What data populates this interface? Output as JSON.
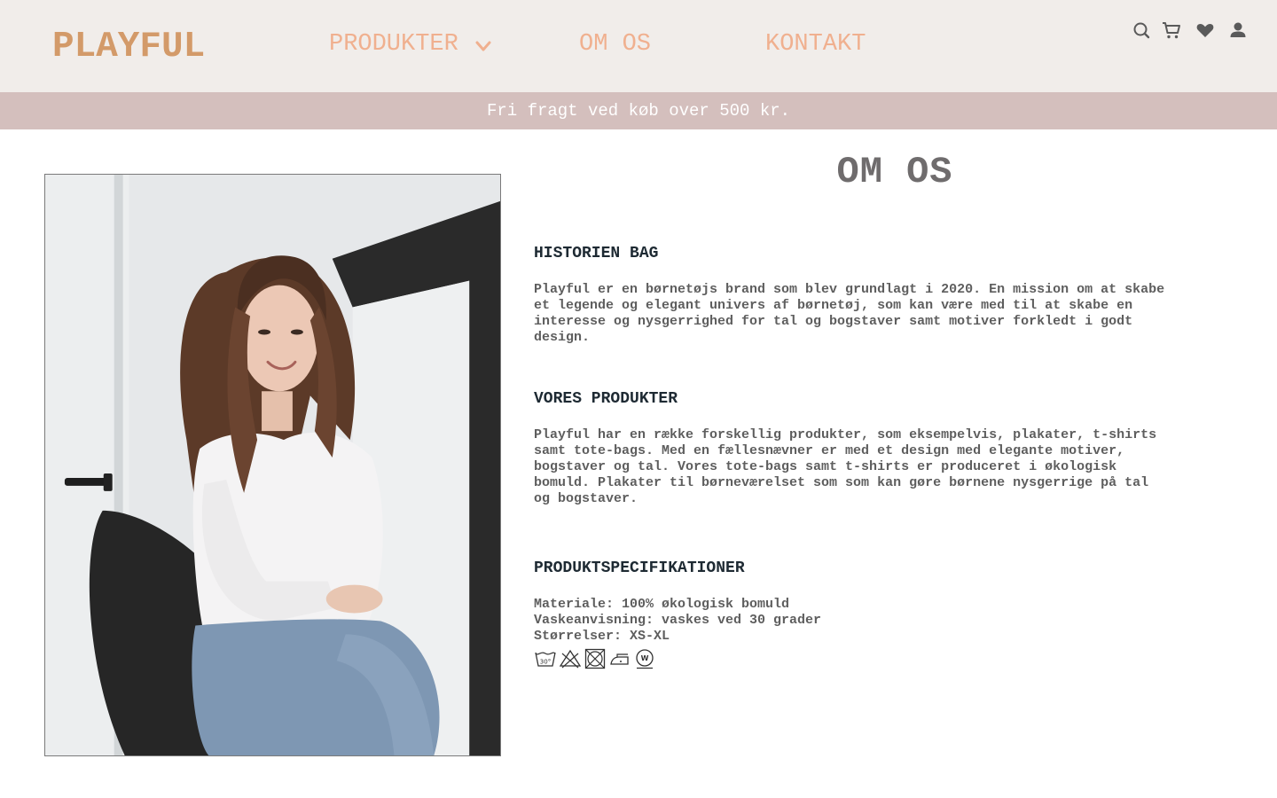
{
  "header": {
    "logo": "PLAYFUL",
    "nav": {
      "produkter": "PRODUKTER",
      "om_os": "OM OS",
      "kontakt": "KONTAKT"
    },
    "icons": [
      "search-icon",
      "cart-icon",
      "heart-icon",
      "user-icon"
    ]
  },
  "banner": {
    "text": "Fri fragt ved køb over 500 kr."
  },
  "main": {
    "title": "OM OS",
    "sections": [
      {
        "title": "HISTORIEN BAG",
        "text": "Playful er en børnetøjs brand som blev grundlagt i 2020. En mission om at skabe\net legende og elegant univers af børnetøj, som kan være med til at skabe en\ninteresse og nysgerrighed for tal og bogstaver samt motiver forkledt i godt\ndesign."
      },
      {
        "title": "VORES PRODUKTER",
        "text": "Playful har en række forskellig produkter, som eksempelvis, plakater, t-shirts\nsamt tote-bags. Med en fællesnævner er med et design med elegante motiver,\nbogstaver og tal. Vores tote-bags samt t-shirts er produceret i økologisk\nbomuld. Plakater til børneværelset som som kan gøre børnene nysgerrige på tal\nog bogstaver."
      },
      {
        "title": "PRODUKTSPECIFIKATIONER",
        "text": "Materiale: 100% økologisk bomuld\nVaskeanvisning: vaskes ved 30 grader\nStørrelser: XS-XL"
      }
    ],
    "care_icons": [
      "wash-30-icon",
      "no-bleach-icon",
      "no-tumble-dry-icon",
      "iron-low-icon",
      "wet-clean-icon"
    ],
    "care_labels": {
      "wash": "30°",
      "wet": "W"
    }
  },
  "colors": {
    "header_bg": "#f1edea",
    "logo": "#d39a69",
    "nav": "#f0b08f",
    "banner_bg": "#d4bfbd",
    "title": "#6f6c6d",
    "section_title": "#1e2a33",
    "body_text": "#5e5e5e"
  }
}
